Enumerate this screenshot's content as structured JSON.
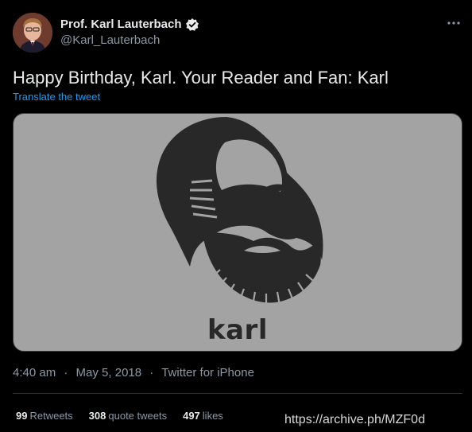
{
  "author": {
    "display_name": "Prof. Karl Lauterbach",
    "handle": "@Karl_Lauterbach",
    "verified": true,
    "avatar_icon": "profile-photo"
  },
  "tweet": {
    "text": "Happy Birthday, Karl. Your Reader and Fan: Karl",
    "translate_label": "Translate the tweet"
  },
  "media": {
    "caption": "karl",
    "illustration": "karl-marx-silhouette-icon"
  },
  "meta": {
    "time": "4:40 am",
    "date": "May 5, 2018",
    "source": "Twitter for iPhone"
  },
  "stats": {
    "retweets_count": "99",
    "retweets_label": "Retweets",
    "quotes_count": "308",
    "quotes_label": "quote tweets",
    "likes_count": "497",
    "likes_label": "likes"
  },
  "overlay": {
    "archive_url": "https://archive.ph/MZF0d"
  },
  "colors": {
    "background": "#000000",
    "link": "#1d9bf0",
    "muted": "#8b98a5",
    "image_bg": "#a3a3a3",
    "silhouette": "#282828"
  }
}
